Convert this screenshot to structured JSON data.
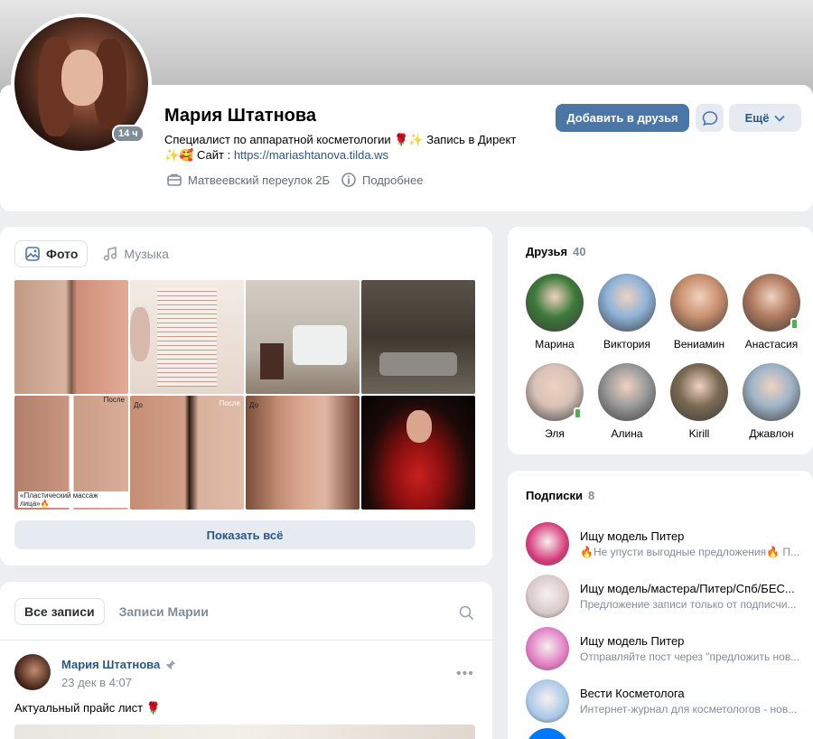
{
  "profile": {
    "name": "Мария Штатнова",
    "time_badge": "14 ч",
    "status_line1": "Специалист по аппаратной косметологии 🌹✨ Запись в Директ",
    "status_line2_prefix": "✨🥰 Сайт : ",
    "status_link": "https://mariashtanova.tilda.ws",
    "address": "Матвеевский переулок 2Б",
    "more_info": "Подробнее",
    "add_friend": "Добавить в друзья",
    "more": "Ещё"
  },
  "media": {
    "tabs": [
      {
        "label": "Фото"
      },
      {
        "label": "Музыка"
      }
    ],
    "photo_labels": {
      "p5_after": "После",
      "p5_caption": "«Пластический массаж лица»🔥",
      "p6_before": "До",
      "p6_after": "После",
      "p7_before": "До"
    },
    "show_all": "Показать всё"
  },
  "posts": {
    "tabs": [
      {
        "label": "Все записи"
      },
      {
        "label": "Записи Марии"
      }
    ],
    "author": "Мария Штатнова",
    "date": "23 дек в 4:07",
    "text": "Актуальный прайс лист 🌹"
  },
  "friends": {
    "title": "Друзья",
    "count": "40",
    "items": [
      {
        "name": "Марина",
        "color": "#3d7a3a",
        "online": false
      },
      {
        "name": "Виктория",
        "color": "#8fb3d9",
        "online": false
      },
      {
        "name": "Вениамин",
        "color": "#c9906e",
        "online": false
      },
      {
        "name": "Анастасия",
        "color": "#b07a60",
        "online": true
      },
      {
        "name": "Эля",
        "color": "#d8c2b8",
        "online": true
      },
      {
        "name": "Алина",
        "color": "#9a9a9a",
        "online": false
      },
      {
        "name": "Kirill",
        "color": "#7a6a52",
        "online": false
      },
      {
        "name": "Джавлон",
        "color": "#9fb4c8",
        "online": false
      }
    ]
  },
  "subscriptions": {
    "title": "Подписки",
    "count": "8",
    "items": [
      {
        "name": "Ищу модель Питер",
        "desc": "🔥Не упусти выгодные предложения🔥 П...",
        "color": "#d63a7a"
      },
      {
        "name": "Ищу модель/мастера/Питер/Спб/БЕС...",
        "desc": "Предложение записи только от подписчи...",
        "color": "#d9c8c8"
      },
      {
        "name": "Ищу модель Питер",
        "desc": "Отправляйте пост через \"предложить нов...",
        "color": "#e07ac0"
      },
      {
        "name": "Вести Косметолога",
        "desc": "Интернет-журнал для косметологов - нов...",
        "color": "#a8c8e8"
      }
    ]
  }
}
